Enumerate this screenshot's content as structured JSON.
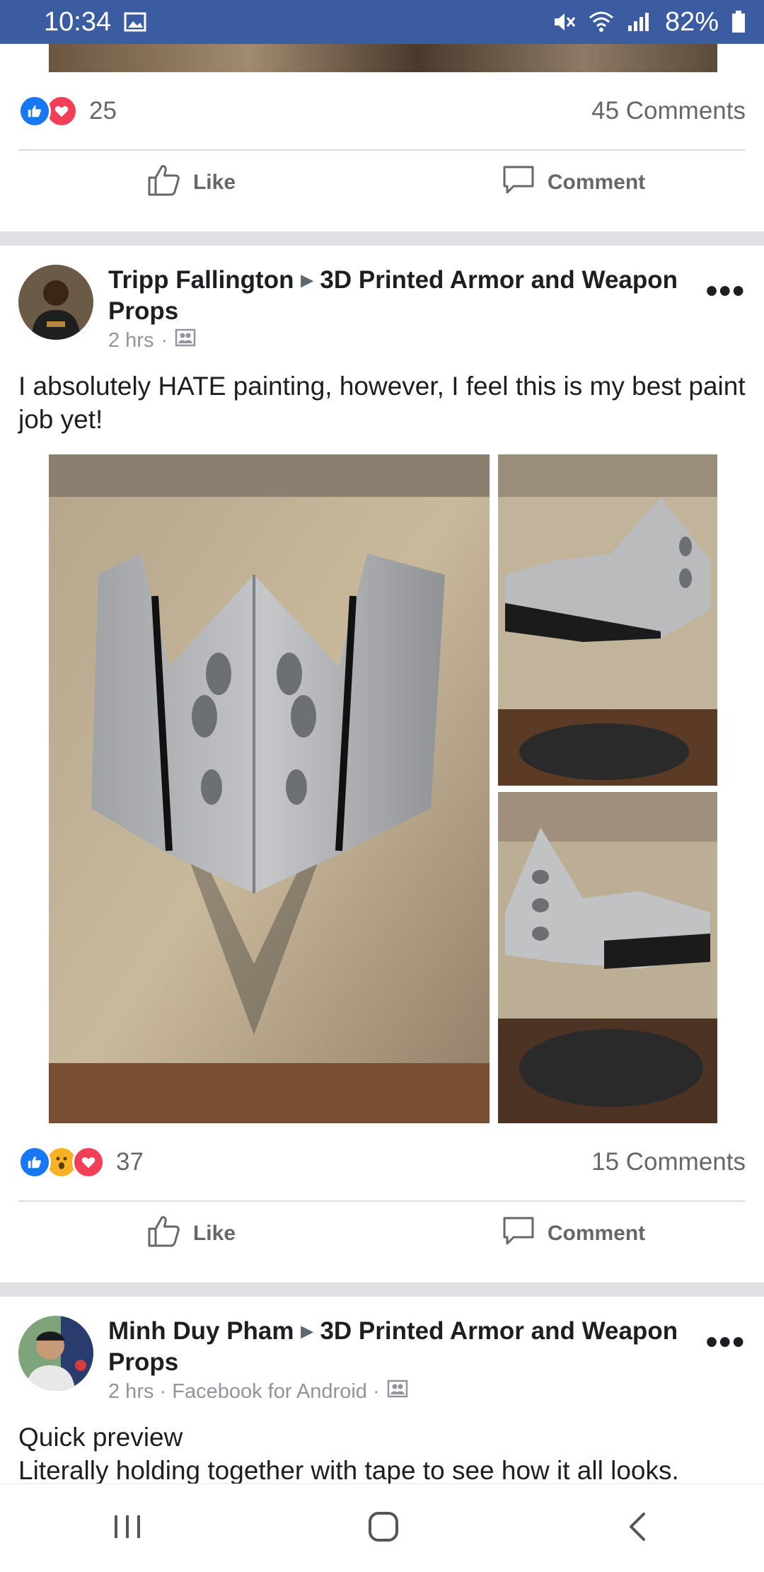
{
  "status_bar": {
    "time": "10:34",
    "battery": "82%"
  },
  "previous_post": {
    "reaction_count": "25",
    "comments": "45 Comments",
    "like_label": "Like",
    "comment_label": "Comment"
  },
  "post1": {
    "author": "Tripp Fallington",
    "group": "3D Printed Armor and Weapon Props",
    "time": "2 hrs",
    "text": "I absolutely HATE painting, however, I feel this is my best paint job yet!",
    "reaction_count": "37",
    "comments": "15 Comments",
    "like_label": "Like",
    "comment_label": "Comment"
  },
  "post2": {
    "author": "Minh Duy Pham",
    "group": "3D Printed Armor and Weapon Props",
    "time": "2 hrs · Facebook for Android ·",
    "text_line1": "Quick preview",
    "text_line2": "Literally holding together with tape to see how it all looks."
  },
  "colors": {
    "status_bar": "#3b5ca0",
    "like_blue": "#1877f2",
    "love_red": "#f33e58",
    "wow_yellow": "#f7b125"
  },
  "icons": [
    "image-icon",
    "mute-icon",
    "wifi-icon",
    "signal-icon",
    "battery-icon",
    "thumbs-up-icon",
    "comment-icon",
    "more-icon",
    "group-icon",
    "recent-apps-icon",
    "home-icon",
    "back-icon"
  ]
}
